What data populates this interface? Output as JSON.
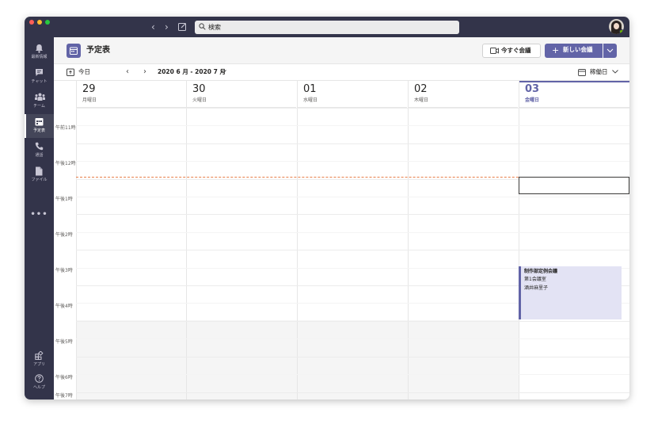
{
  "titlebar": {
    "search_placeholder": "検索",
    "back_icon": "chevron-left-icon",
    "forward_icon": "chevron-right-icon",
    "compose_icon": "compose-icon"
  },
  "rail": {
    "items": [
      {
        "label": "最新情報",
        "icon": "bell-icon"
      },
      {
        "label": "チャット",
        "icon": "chat-icon"
      },
      {
        "label": "チーム",
        "icon": "teams-icon"
      },
      {
        "label": "予定表",
        "icon": "calendar-icon",
        "active": true
      },
      {
        "label": "通話",
        "icon": "phone-icon"
      },
      {
        "label": "ファイル",
        "icon": "file-icon"
      }
    ],
    "more": "•••",
    "apps_label": "アプリ",
    "help_label": "ヘルプ"
  },
  "header": {
    "title": "予定表",
    "meet_now": "今すぐ会議",
    "new_meeting": "新しい会議"
  },
  "toolbar": {
    "today": "今日",
    "range": "2020 6 月 - 2020 7 月",
    "view": "稼働日"
  },
  "days": [
    {
      "num": "29",
      "weekday": "月曜日"
    },
    {
      "num": "30",
      "weekday": "火曜日"
    },
    {
      "num": "01",
      "weekday": "水曜日"
    },
    {
      "num": "02",
      "weekday": "木曜日"
    },
    {
      "num": "03",
      "weekday": "金曜日",
      "today": true
    }
  ],
  "times": [
    "午前11時",
    "午後12時",
    "午後1時",
    "午後2時",
    "午後3時",
    "午後4時",
    "午後5時",
    "午後6時",
    "午後7時"
  ],
  "event": {
    "title": "制作部定例会議",
    "location": "第1会議室",
    "organizer": "酒井麻里子"
  },
  "colors": {
    "accent": "#6264a7",
    "rail": "#33344a",
    "now_line": "#e8804a",
    "event_bg": "#e3e3f4"
  }
}
